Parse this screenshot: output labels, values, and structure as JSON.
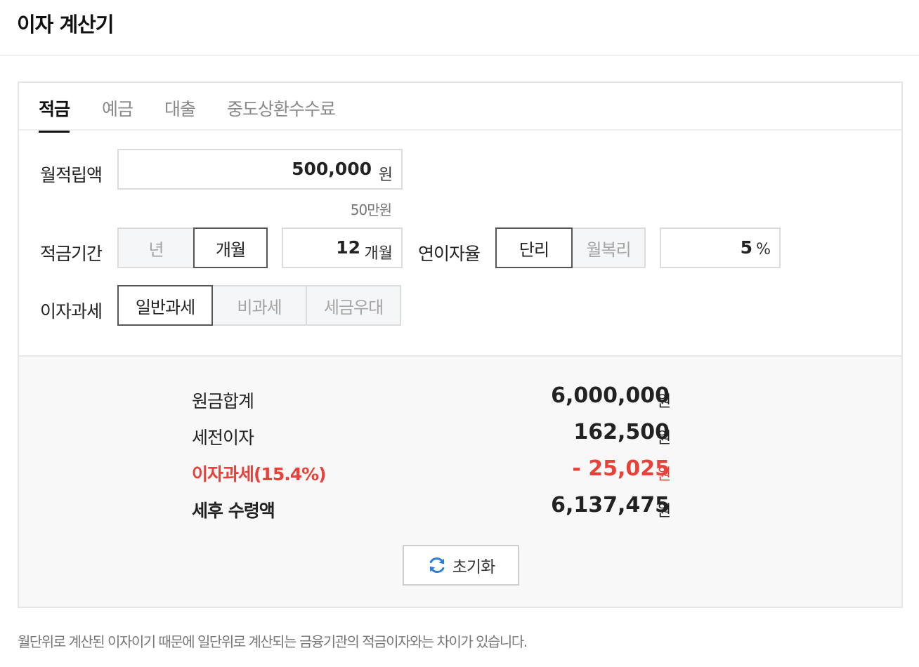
{
  "page": {
    "title": "이자 계산기"
  },
  "tabs": [
    {
      "label": "적금",
      "active": true
    },
    {
      "label": "예금",
      "active": false
    },
    {
      "label": "대출",
      "active": false
    },
    {
      "label": "중도상환수수료",
      "active": false
    }
  ],
  "form": {
    "monthly_deposit": {
      "label": "월적립액",
      "value": "500,000",
      "unit": "원",
      "hint": "50만원"
    },
    "period": {
      "label": "적금기간",
      "options": [
        {
          "label": "년",
          "selected": false
        },
        {
          "label": "개월",
          "selected": true
        }
      ],
      "value": "12",
      "unit": "개월"
    },
    "rate": {
      "label": "연이자율",
      "options": [
        {
          "label": "단리",
          "selected": true
        },
        {
          "label": "월복리",
          "selected": false
        }
      ],
      "value": "5",
      "unit": "%"
    },
    "tax": {
      "label": "이자과세",
      "options": [
        {
          "label": "일반과세",
          "selected": true
        },
        {
          "label": "비과세",
          "selected": false
        },
        {
          "label": "세금우대",
          "selected": false
        }
      ]
    }
  },
  "results": {
    "principal": {
      "label": "원금합계",
      "value": "6,000,000",
      "unit": "원"
    },
    "pretax_interest": {
      "label": "세전이자",
      "value": "162,500",
      "unit": "원"
    },
    "tax": {
      "label": "이자과세(15.4%)",
      "value": "- 25,025",
      "unit": "원"
    },
    "net": {
      "label": "세후 수령액",
      "value": "6,137,475",
      "unit": "원"
    }
  },
  "reset": {
    "label": "초기화",
    "icon": "refresh-icon"
  },
  "footnote": "월단위로 계산된 이자이기 때문에 일단위로 계산되는 금융기관의 적금이자와는 차이가 있습니다.",
  "colors": {
    "accent_red": "#e8413a",
    "refresh_icon": "#2f7bd9"
  }
}
